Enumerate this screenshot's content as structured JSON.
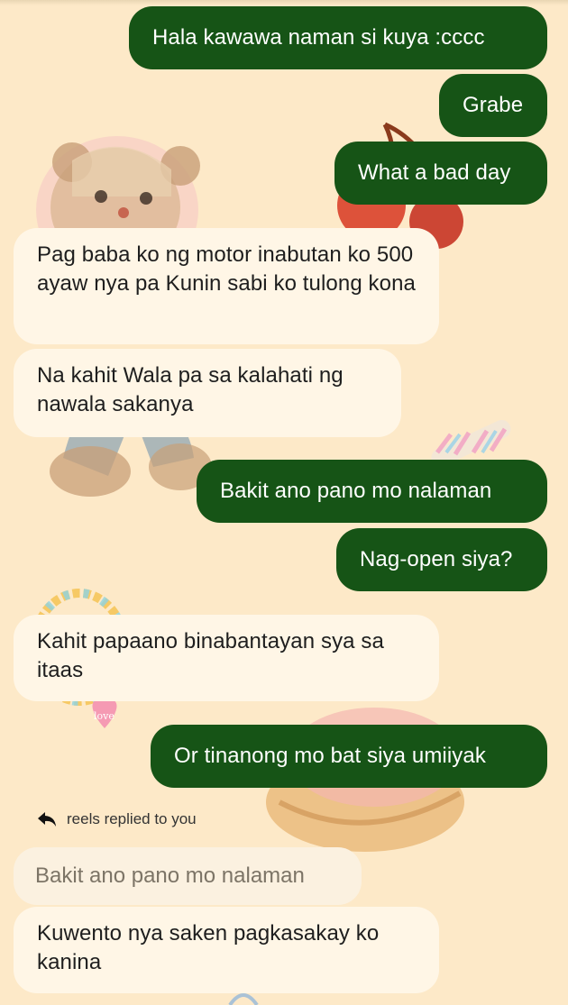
{
  "messages": [
    {
      "dir": "out",
      "text": "Hala kawawa naman si kuya :cccc"
    },
    {
      "dir": "out",
      "text": "Grabe"
    },
    {
      "dir": "out",
      "text": "What a bad day"
    },
    {
      "dir": "in",
      "text": "Pag baba ko ng motor inabutan ko 500 ayaw nya pa Kunin sabi ko tulong kona"
    },
    {
      "dir": "in",
      "text": "Na kahit Wala pa sa kalahati ng nawala sakanya"
    },
    {
      "dir": "out",
      "text": "Bakit ano pano mo nalaman"
    },
    {
      "dir": "out",
      "text": "Nag-open siya?"
    },
    {
      "dir": "in",
      "text": "Kahit papaano binabantayan sya sa itaas"
    },
    {
      "dir": "out",
      "text": "Or tinanong mo bat siya umiiyak"
    },
    {
      "dir": "in",
      "text": "Kuwento nya saken pagkasakay ko kanina"
    }
  ],
  "reply": {
    "context_label": "reels replied to you",
    "quoted_text": "Bakit ano pano mo nalaman",
    "icon": "reply-arrow-icon"
  },
  "colors": {
    "background": "#fde9c8",
    "outgoing_bubble": "#165416",
    "incoming_bubble": "#fff6e6"
  },
  "stickers": [
    "teddy-bear",
    "cherries",
    "marshmallow-twist",
    "candy-bracelet",
    "donut"
  ]
}
